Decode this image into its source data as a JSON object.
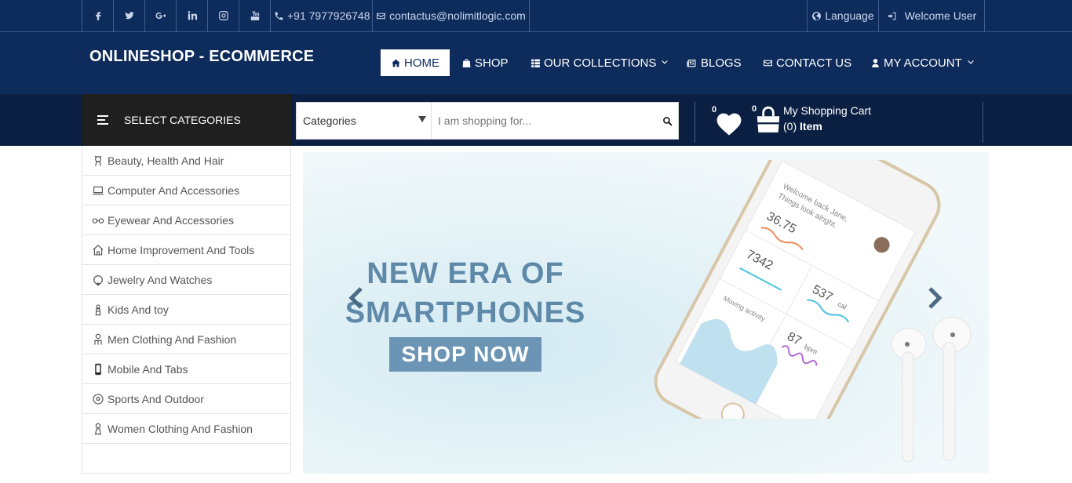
{
  "topbar": {
    "social": [
      {
        "icon": "facebook-icon"
      },
      {
        "icon": "twitter-icon"
      },
      {
        "icon": "google-plus-icon"
      },
      {
        "icon": "linkedin-icon"
      },
      {
        "icon": "instagram-icon"
      },
      {
        "icon": "youtube-icon"
      }
    ],
    "phone": "+91 7977926748",
    "email": "contactus@nolimitlogic.com",
    "language": "Language",
    "welcome": "Welcome User"
  },
  "header": {
    "brand": "ONLINESHOP - ECOMMERCE",
    "nav": {
      "home": "HOME",
      "shop": "SHOP",
      "collections": "OUR COLLECTIONS",
      "blogs": "BLOGS",
      "contact": "CONTACT US",
      "account": "MY ACCOUNT"
    }
  },
  "search": {
    "category_button": "SELECT CATEGORIES",
    "select_value": "Categories",
    "placeholder": "I am shopping for...",
    "wishlist_count": "0",
    "cart_count_badge": "0",
    "cart_title": "My Shopping Cart",
    "cart_count": "(0)",
    "cart_unit": "Item"
  },
  "sidebar": {
    "items": [
      {
        "label": "Beauty, Health And Hair"
      },
      {
        "label": "Computer And Accessories"
      },
      {
        "label": "Eyewear And Accessories"
      },
      {
        "label": "Home Improvement And Tools"
      },
      {
        "label": "Jewelry And Watches"
      },
      {
        "label": "Kids And toy"
      },
      {
        "label": "Men Clothing And Fashion"
      },
      {
        "label": "Mobile And Tabs"
      },
      {
        "label": "Sports And Outdoor"
      },
      {
        "label": "Women Clothing And Fashion"
      }
    ]
  },
  "hero": {
    "line1": "NEW ERA OF",
    "line2": "SMARTPHONES",
    "cta": "SHOP NOW",
    "phone_screen": {
      "greeting": "Welcome back Jane,",
      "greeting2": "Things look alright.",
      "stat1": "36.75",
      "stat2": "537",
      "stat2_unit": "cal",
      "stat3": "7342",
      "stat4": "87",
      "stat4_unit": "bpm",
      "activity": "Moving activity"
    }
  },
  "colors": {
    "navy": "#0d2b5b",
    "dark_navy": "#0a1f42",
    "hero_text": "#5f89a8",
    "cta": "#6c95b5"
  }
}
